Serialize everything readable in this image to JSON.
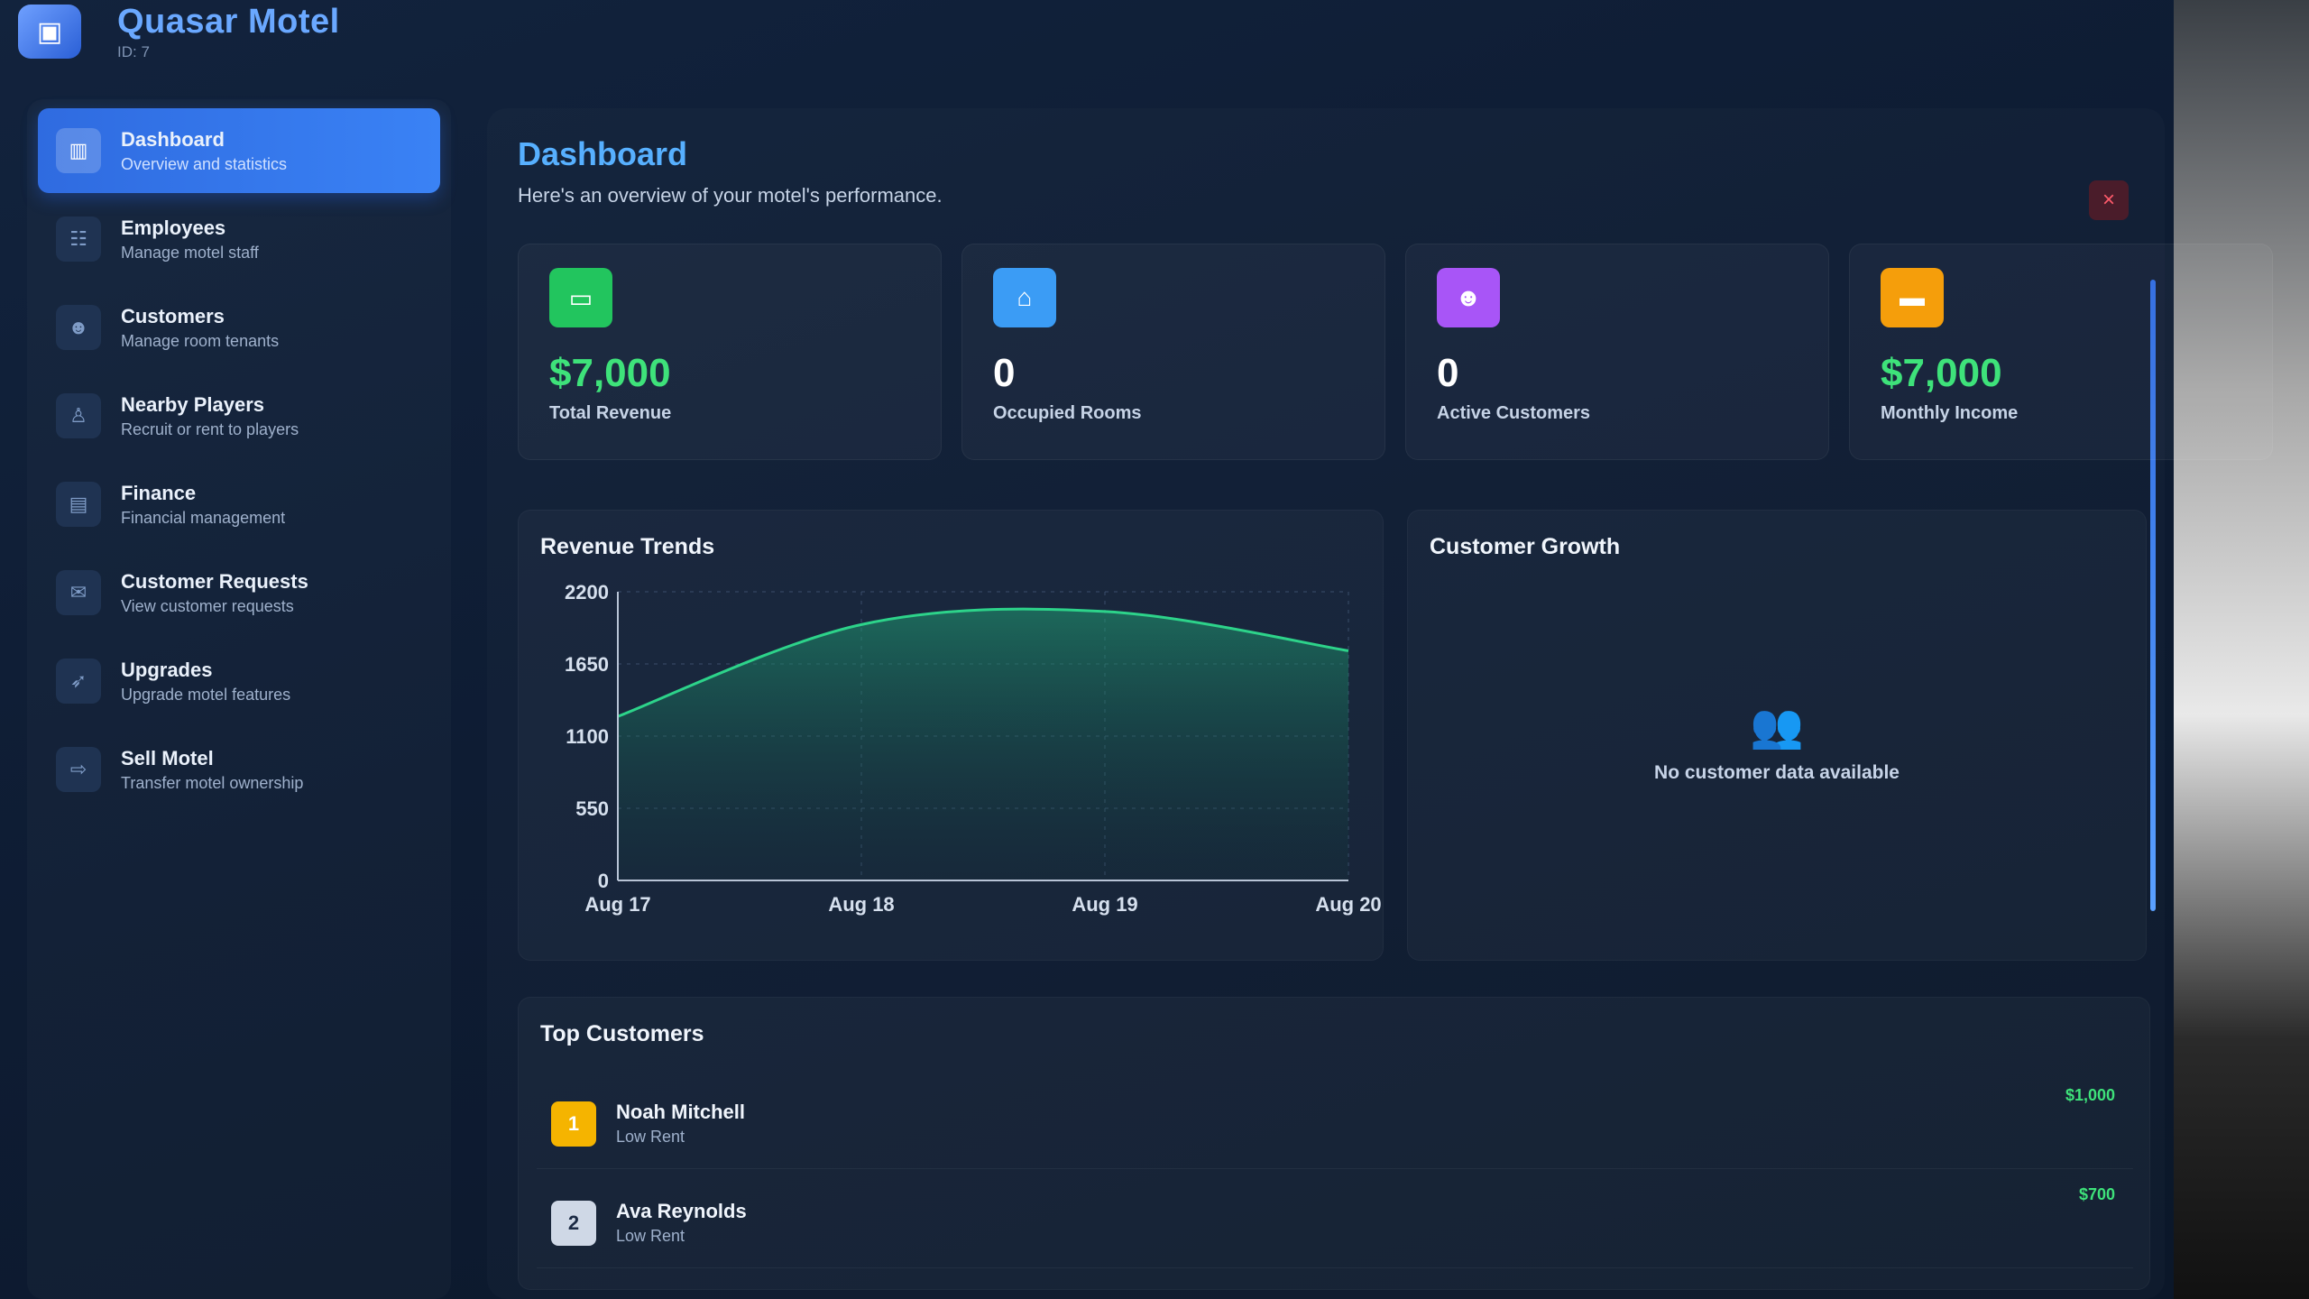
{
  "app": {
    "title": "Quasar Motel",
    "id_text": "ID: 7",
    "logo_icon": "motel-icon"
  },
  "sidebar": {
    "items": [
      {
        "label": "Dashboard",
        "desc": "Overview and statistics",
        "icon": "chart-icon",
        "active": true
      },
      {
        "label": "Employees",
        "desc": "Manage motel staff",
        "icon": "employees-icon",
        "active": false
      },
      {
        "label": "Customers",
        "desc": "Manage room tenants",
        "icon": "customers-icon",
        "active": false
      },
      {
        "label": "Nearby Players",
        "desc": "Recruit or rent to players",
        "icon": "user-icon",
        "active": false
      },
      {
        "label": "Finance",
        "desc": "Financial management",
        "icon": "wallet-icon",
        "active": false
      },
      {
        "label": "Customer Requests",
        "desc": "View customer requests",
        "icon": "mail-icon",
        "active": false
      },
      {
        "label": "Upgrades",
        "desc": "Upgrade motel features",
        "icon": "rocket-icon",
        "active": false
      },
      {
        "label": "Sell Motel",
        "desc": "Transfer motel ownership",
        "icon": "transfer-icon",
        "active": false
      }
    ]
  },
  "main": {
    "title": "Dashboard",
    "subtitle": "Here's an overview of your motel's performance.",
    "close_label": "×",
    "stats": [
      {
        "value": "$7,000",
        "label": "Total Revenue",
        "icon": "card-icon",
        "color": "#22c55e",
        "money": true
      },
      {
        "value": "0",
        "label": "Occupied Rooms",
        "icon": "home-icon",
        "color": "#3b9cf5",
        "money": false
      },
      {
        "value": "0",
        "label": "Active Customers",
        "icon": "users-icon",
        "color": "#a855f7",
        "money": false
      },
      {
        "value": "$7,000",
        "label": "Monthly Income",
        "icon": "bed-icon",
        "color": "#f59e0b",
        "money": true
      }
    ],
    "revenue_title": "Revenue Trends",
    "growth_title": "Customer Growth",
    "growth_empty": "No customer data available",
    "top_title": "Top Customers",
    "top_customers": [
      {
        "rank": "1",
        "name": "Noah Mitchell",
        "type": "Low Rent",
        "amount": "$1,000",
        "badge_color": "#f5b400",
        "badge_text_color": "#ffffff"
      },
      {
        "rank": "2",
        "name": "Ava Reynolds",
        "type": "Low Rent",
        "amount": "$700",
        "badge_color": "#cfd8e6",
        "badge_text_color": "#1b2a44"
      }
    ]
  },
  "chart_data": {
    "type": "area",
    "title": "Revenue Trends",
    "x": [
      "Aug 17",
      "Aug 18",
      "Aug 19",
      "Aug 20"
    ],
    "series": [
      {
        "values": [
          1250,
          1950,
          2050,
          1750
        ]
      }
    ],
    "yticks": [
      0,
      550,
      1100,
      1650,
      2200
    ],
    "ylim": [
      0,
      2200
    ],
    "grid": true,
    "color": "#2dd38a"
  }
}
